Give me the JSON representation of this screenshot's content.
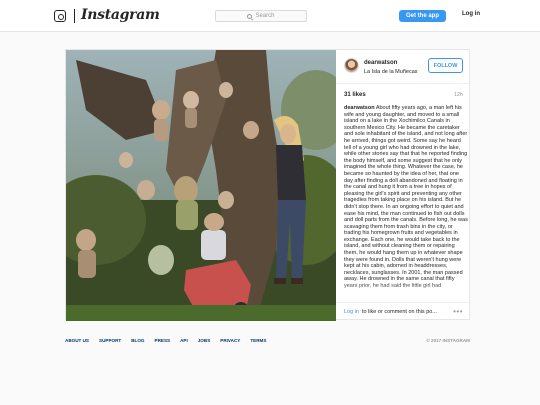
{
  "header": {
    "wordmark": "Instagram",
    "search_placeholder": "Search",
    "get_app_label": "Get the app",
    "login_label": "Log in"
  },
  "post": {
    "username": "dearwatson",
    "location": "La Isla de la Muñecas",
    "follow_label": "FOLLOW",
    "likes": "31 likes",
    "age": "12h",
    "caption_user": "dearwatson",
    "caption_text": "About fifty years ago, a man left his wife and young daughter, and moved to a small island on a lake in the Xochimilco Canals in southern Mexico City. He became the caretaker and sole inhabitant of the island, and not long after he arrived, things got weird. Some say he heard tell of a young girl who had drowned in the lake, while other stories say that that he reported finding the body himself, and some suggest that he only imagined the whole thing. Whatever the case, he became so haunted by the idea of her, that one day after finding a doll abandoned and floating in the canal and hung it from a tree in hopes of pleasing the girl's spirit and preventing any other tragedies from taking place on his island. But he didn't stop there. In an ongoing effort to quiet and ease his mind, the man continued to fish out dolls and doll parts from the canals. Before long, he was scavaging them from trash bins in the city, or trading his homegrown fruits and vegetables in exchange. Each one, he would take back to the island, and without cleaning them or repairing them, he would hang them up in whatever shape they were found in. Dolls that weren't hung were kept at his cabin, adorned in headdresses, necklaces, sunglasses. In 2001, the man passed away. He drowned in the same canal that fifty years prior, he had said the little girl had",
    "comment_login": "Log in",
    "comment_text": "to like or comment on this po...",
    "more_glyph": "•••"
  },
  "footer": {
    "links": [
      "ABOUT US",
      "SUPPORT",
      "BLOG",
      "PRESS",
      "API",
      "JOBS",
      "PRIVACY",
      "TERMS"
    ],
    "copyright": "© 2017 INSTAGRAM"
  },
  "colors": {
    "accent": "#3897f0",
    "footer_link": "#003569",
    "background": "#fafafa"
  },
  "icons": {
    "logo": "instagram-camera-icon",
    "search": "search-icon",
    "more": "more-options-icon"
  }
}
